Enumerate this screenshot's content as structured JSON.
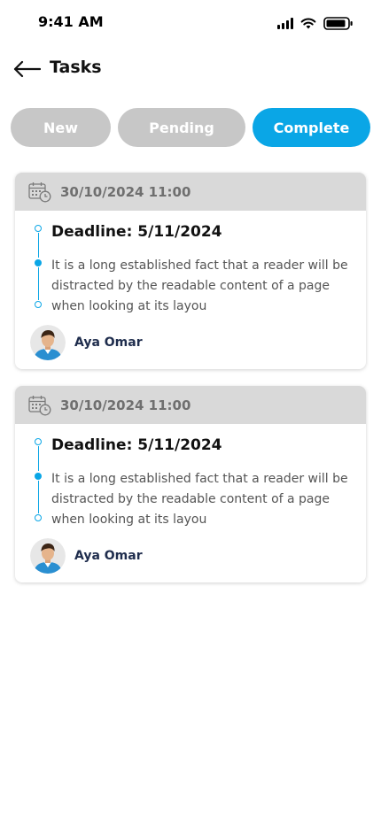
{
  "status_bar": {
    "time": "9:41 AM"
  },
  "header": {
    "title": "Tasks",
    "back_icon": "arrow-left-icon"
  },
  "tabs": [
    {
      "label": "New",
      "active": false
    },
    {
      "label": "Pending",
      "active": false
    },
    {
      "label": "Complete",
      "active": true
    }
  ],
  "colors": {
    "accent": "#0aa6e6",
    "tab_inactive": "#c7c7c7",
    "card_header": "#d9d9d9",
    "user_name": "#1f2d4d"
  },
  "tasks": [
    {
      "date": "30/10/2024 11:00",
      "deadline": "Deadline: 5/11/2024",
      "description": "It is a long established fact that a reader will be distracted by the readable content of a page when looking at its layou",
      "user": "Aya Omar"
    },
    {
      "date": "30/10/2024 11:00",
      "deadline": "Deadline: 5/11/2024",
      "description": "It is a long established fact that a reader will be distracted by the readable content of a page when looking at its layou",
      "user": "Aya Omar"
    }
  ]
}
